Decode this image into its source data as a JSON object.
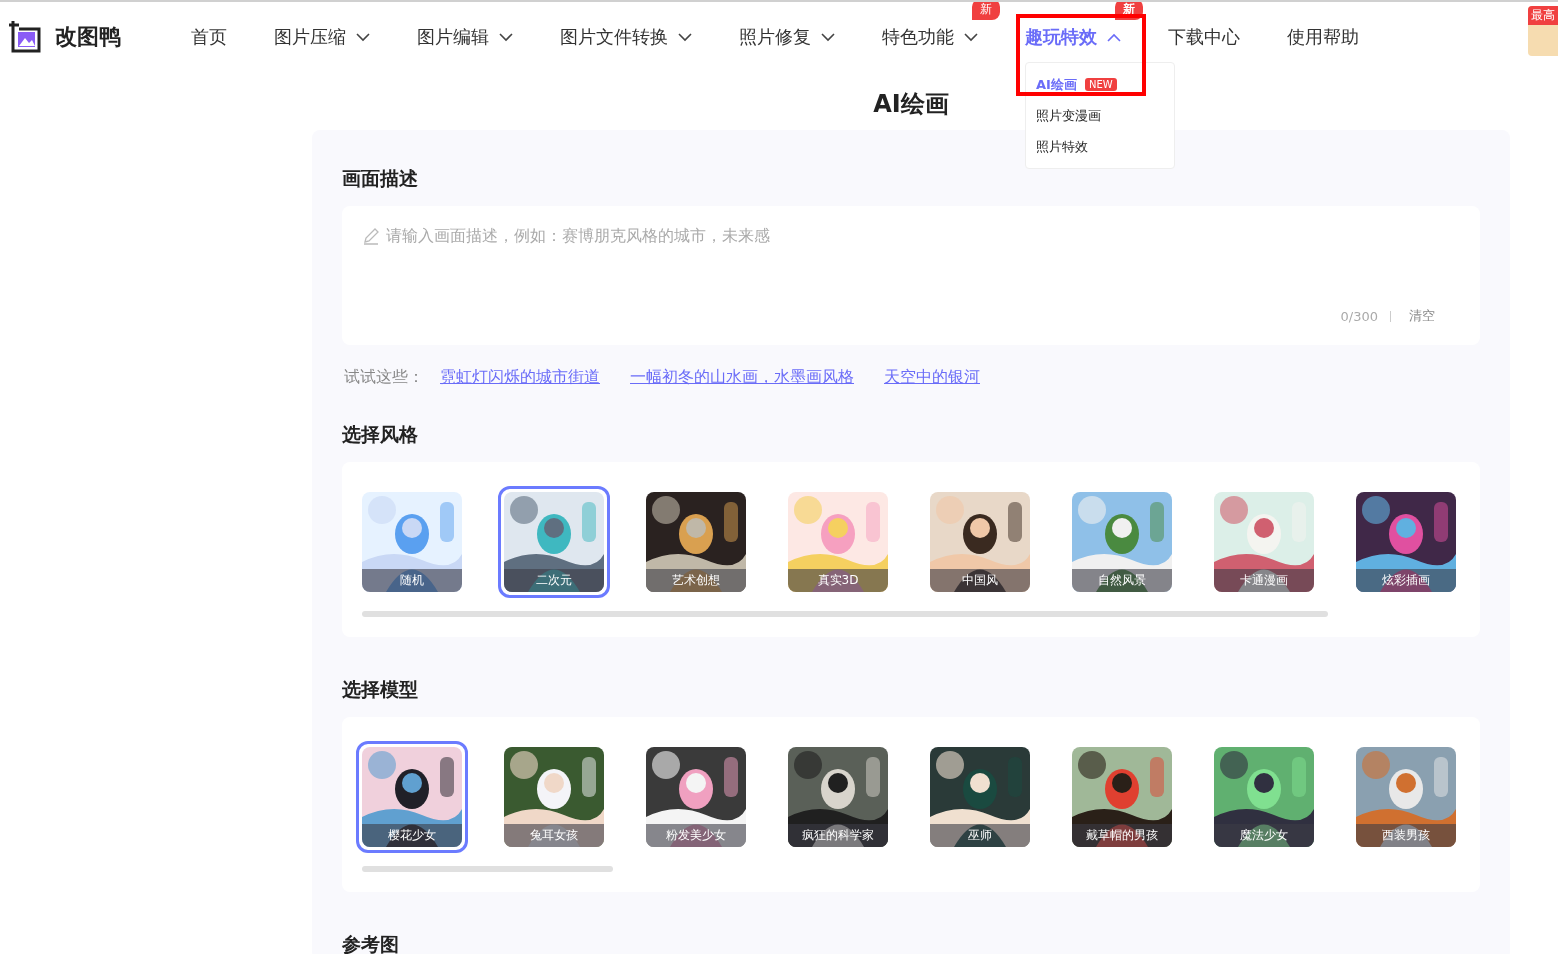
{
  "header": {
    "logo": "改图鸭",
    "nav": [
      {
        "label": "首页",
        "kind": "link",
        "selected": false
      },
      {
        "label": "图片压缩",
        "kind": "menu",
        "expanded": false,
        "selected": false
      },
      {
        "label": "图片编辑",
        "kind": "menu",
        "expanded": false,
        "selected": false
      },
      {
        "label": "图片文件转换",
        "kind": "menu",
        "expanded": false,
        "selected": false
      },
      {
        "label": "照片修复",
        "kind": "menu",
        "expanded": false,
        "selected": false
      },
      {
        "label": "特色功能",
        "kind": "menu",
        "expanded": false,
        "selected": false,
        "badge": "新"
      },
      {
        "label": "趣玩特效",
        "kind": "menu",
        "expanded": true,
        "selected": true,
        "badge": "新"
      },
      {
        "label": "下载中心",
        "kind": "link",
        "selected": false
      },
      {
        "label": "使用帮助",
        "kind": "link",
        "selected": false
      }
    ],
    "dropdown": [
      {
        "label": "AI绘画",
        "selected": true,
        "badge": "NEW"
      },
      {
        "label": "照片变漫画",
        "selected": false
      },
      {
        "label": "照片特效",
        "selected": false
      }
    ],
    "corner_badge": "最高"
  },
  "page_title": "AI绘画",
  "description": {
    "heading": "画面描述",
    "placeholder": "请输入画面描述，例如：赛博朋克风格的城市，未来感",
    "counter": "0/300",
    "clear": "清空"
  },
  "suggestions": {
    "label": "试试这些：",
    "links": [
      "霓虹灯闪烁的城市街道",
      "一幅初冬的山水画，水墨画风格",
      "天空中的银河"
    ]
  },
  "styles": {
    "heading": "选择风格",
    "items": [
      {
        "label": "随机",
        "selected": false
      },
      {
        "label": "二次元",
        "selected": true
      },
      {
        "label": "艺术创想",
        "selected": false
      },
      {
        "label": "真实3D",
        "selected": false
      },
      {
        "label": "中国风",
        "selected": false
      },
      {
        "label": "自然风景",
        "selected": false
      },
      {
        "label": "卡通漫画",
        "selected": false
      },
      {
        "label": "炫彩插画",
        "selected": false
      }
    ]
  },
  "models": {
    "heading": "选择模型",
    "items": [
      {
        "label": "樱花少女",
        "selected": true
      },
      {
        "label": "兔耳女孩",
        "selected": false
      },
      {
        "label": "粉发美少女",
        "selected": false
      },
      {
        "label": "疯狂的科学家",
        "selected": false
      },
      {
        "label": "巫师",
        "selected": false
      },
      {
        "label": "戴草帽的男孩",
        "selected": false
      },
      {
        "label": "魔法少女",
        "selected": false
      },
      {
        "label": "西装男孩",
        "selected": false
      }
    ]
  },
  "reference": {
    "heading": "参考图"
  }
}
